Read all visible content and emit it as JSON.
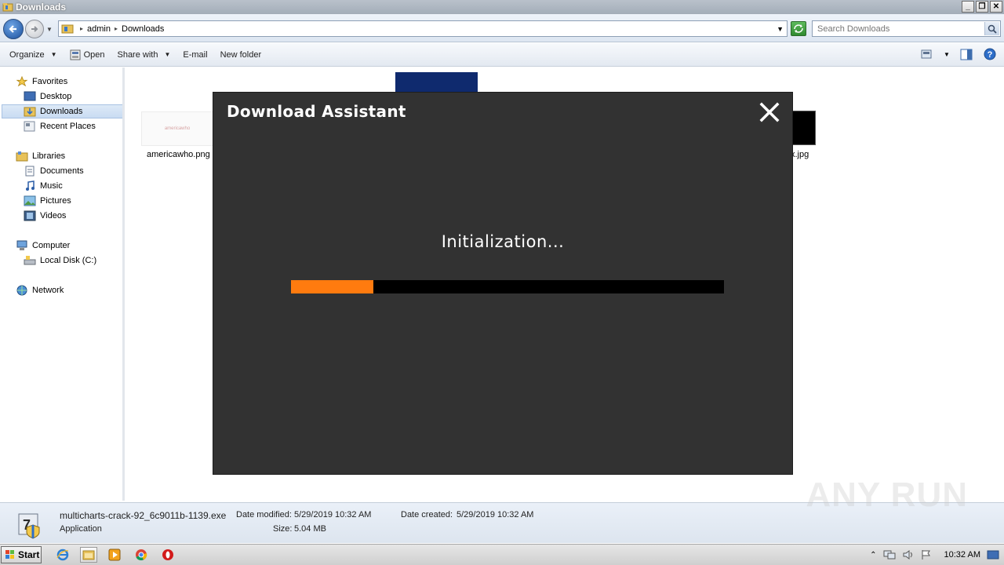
{
  "window": {
    "title": "Downloads"
  },
  "address": {
    "crumbs": [
      "admin",
      "Downloads"
    ],
    "search_placeholder": "Search Downloads"
  },
  "toolbar": {
    "organize": "Organize",
    "open": "Open",
    "share_with": "Share with",
    "email": "E-mail",
    "new_folder": "New folder"
  },
  "nav": {
    "favorites": "Favorites",
    "desktop": "Desktop",
    "downloads": "Downloads",
    "recent_places": "Recent Places",
    "libraries": "Libraries",
    "documents": "Documents",
    "music": "Music",
    "pictures": "Pictures",
    "videos": "Videos",
    "computer": "Computer",
    "local_disk": "Local Disk (C:)",
    "network": "Network"
  },
  "files": [
    {
      "name": "americawho.png",
      "thumb_text": "americawho"
    },
    {
      "name": "x.jpg"
    }
  ],
  "details": {
    "filename": "multicharts-crack-92_6c9011b-1139.exe",
    "type": "Application",
    "date_modified_label": "Date modified:",
    "date_modified": "5/29/2019 10:32 AM",
    "date_created_label": "Date created:",
    "date_created": "5/29/2019 10:32 AM",
    "size_label": "Size:",
    "size": "5.04 MB"
  },
  "watermark": "ANY RUN",
  "taskbar": {
    "start": "Start",
    "clock": "10:32 AM"
  },
  "dialog": {
    "title": "Download Assistant",
    "status": "Initialization...",
    "progress": 0.19,
    "progress_color": "#ff7b0f"
  }
}
